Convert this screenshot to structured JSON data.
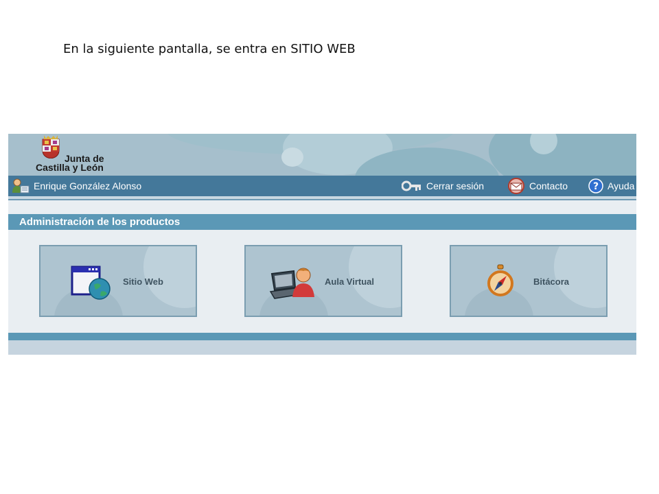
{
  "caption": "En la siguiente pantalla, se entra en SITIO WEB",
  "header": {
    "logo_line1": "Junta de",
    "logo_line2": "Castilla y León"
  },
  "userbar": {
    "user_name": "Enrique González Alonso",
    "logout_label": "Cerrar sesión",
    "contact_label": "Contacto",
    "help_label": "Ayuda"
  },
  "section": {
    "title": "Administración de los productos"
  },
  "products": [
    {
      "label": "Sitio Web",
      "icon": "website-globe-icon"
    },
    {
      "label": "Aula Virtual",
      "icon": "laptop-user-icon"
    },
    {
      "label": "Bitácora",
      "icon": "compass-icon"
    }
  ],
  "colors": {
    "banner": "#a6bfcc",
    "userbar": "#44789a",
    "section_bar": "#5b98b6",
    "tile_bg": "#aec4d0",
    "tile_border": "#7a9db0"
  }
}
